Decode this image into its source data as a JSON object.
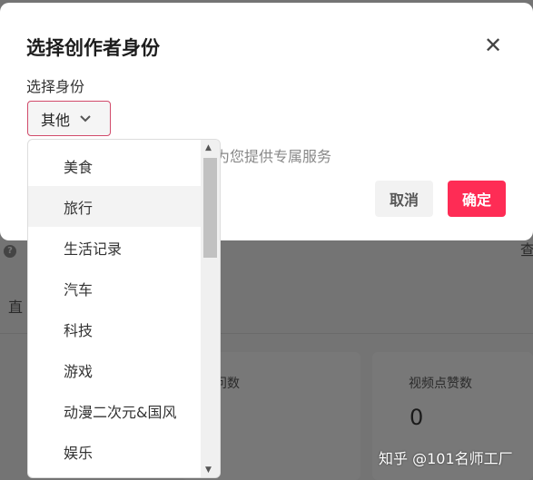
{
  "background": {
    "help_icon": "question-circle-icon",
    "left_text": "直",
    "right_text": "查",
    "card1_label": "问数",
    "card2_label": "视频点赞数",
    "card2_value": "0"
  },
  "modal": {
    "title": "选择创作者身份",
    "close_icon": "close-icon",
    "field_label": "选择身份",
    "selected": "其他",
    "hint": "好的为您提供专属服务",
    "cancel": "取消",
    "confirm": "确定",
    "accent": "#fe2c55"
  },
  "dropdown": {
    "items": [
      "美食",
      "旅行",
      "生活记录",
      "汽车",
      "科技",
      "游戏",
      "动漫二次元&国风",
      "娱乐"
    ],
    "hovered": "旅行"
  },
  "watermark": "知乎 @101名师工厂"
}
